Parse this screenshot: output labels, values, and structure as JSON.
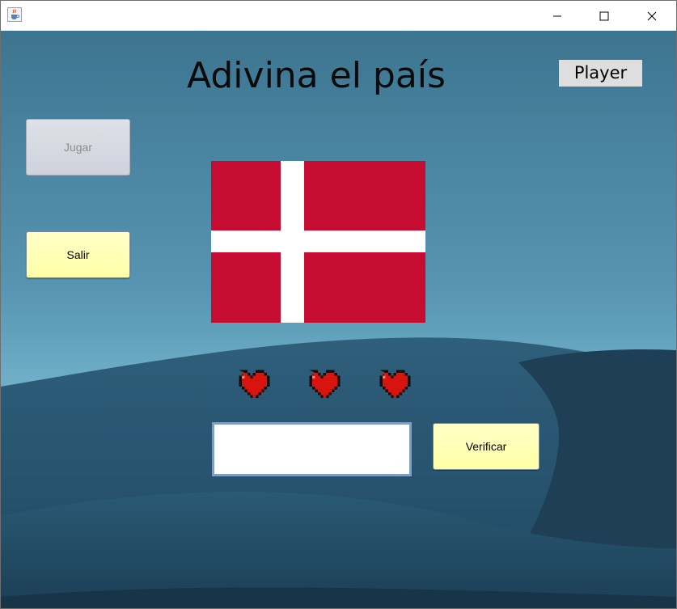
{
  "window": {
    "app_icon": "java-cup-icon",
    "controls": [
      "minimize-icon",
      "maximize-icon",
      "close-icon"
    ]
  },
  "game": {
    "title": "Adivina el país",
    "player_label": "Player",
    "play_button": "Jugar",
    "play_button_enabled": false,
    "exit_button": "Salir",
    "verify_button": "Verificar",
    "answer_value": "",
    "flag": "denmark-flag",
    "lives": 3,
    "life_icon": "pixel-heart-icon"
  },
  "colors": {
    "flag_red": "#c60c30",
    "flag_white": "#ffffff",
    "heart_red": "#d8140e",
    "button_yellow": "#ffffb4",
    "sky": "#4a8fae",
    "dune": "#27506a"
  }
}
